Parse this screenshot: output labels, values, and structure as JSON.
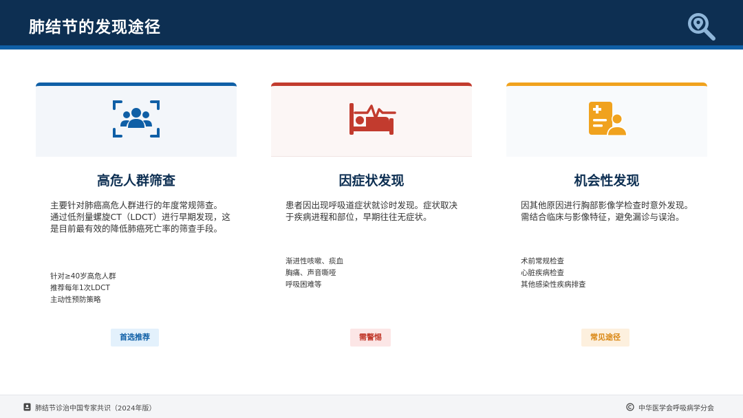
{
  "header": {
    "title": "肺结节的发现途径",
    "logo_icon": "magnifier-location-icon"
  },
  "colors": {
    "navy": "#0d2f52",
    "blue": "#0f5fa6",
    "red": "#c23b2e",
    "orange": "#f0a21e"
  },
  "cards": [
    {
      "icon": "group-scan-icon",
      "title": "高危人群筛查",
      "description": "主要针对肺癌高危人群进行的年度常规筛查。通过低剂量螺旋CT（LDCT）进行早期发现，这是目前最有效的降低肺癌死亡率的筛查手段。",
      "points": [
        "针对≥40岁高危人群",
        "推荐每年1次LDCT",
        "主动性预防策略"
      ],
      "tag": "首选推荐"
    },
    {
      "icon": "hospital-bed-pulse-icon",
      "title": "因症状发现",
      "description": "患者因出现呼吸道症状就诊时发现。症状取决于疾病进程和部位，早期往往无症状。",
      "points": [
        "渐进性咳嗽、痰血",
        "胸痛、声音嘶哑",
        "呼吸困难等"
      ],
      "tag": "需警惕"
    },
    {
      "icon": "medical-report-user-icon",
      "title": "机会性发现",
      "description": "因其他原因进行胸部影像学检查时意外发现。需结合临床与影像特征，避免漏诊与误治。",
      "points": [
        "术前常规检查",
        "心脏疾病检查",
        "其他感染性疾病排查"
      ],
      "tag": "常见途径"
    }
  ],
  "footer": {
    "source": "肺结节诊治中国专家共识（2024年版）",
    "source_icon": "book-icon",
    "copyright": "中华医学会呼吸病学分会",
    "copyright_icon": "copyright-icon"
  }
}
